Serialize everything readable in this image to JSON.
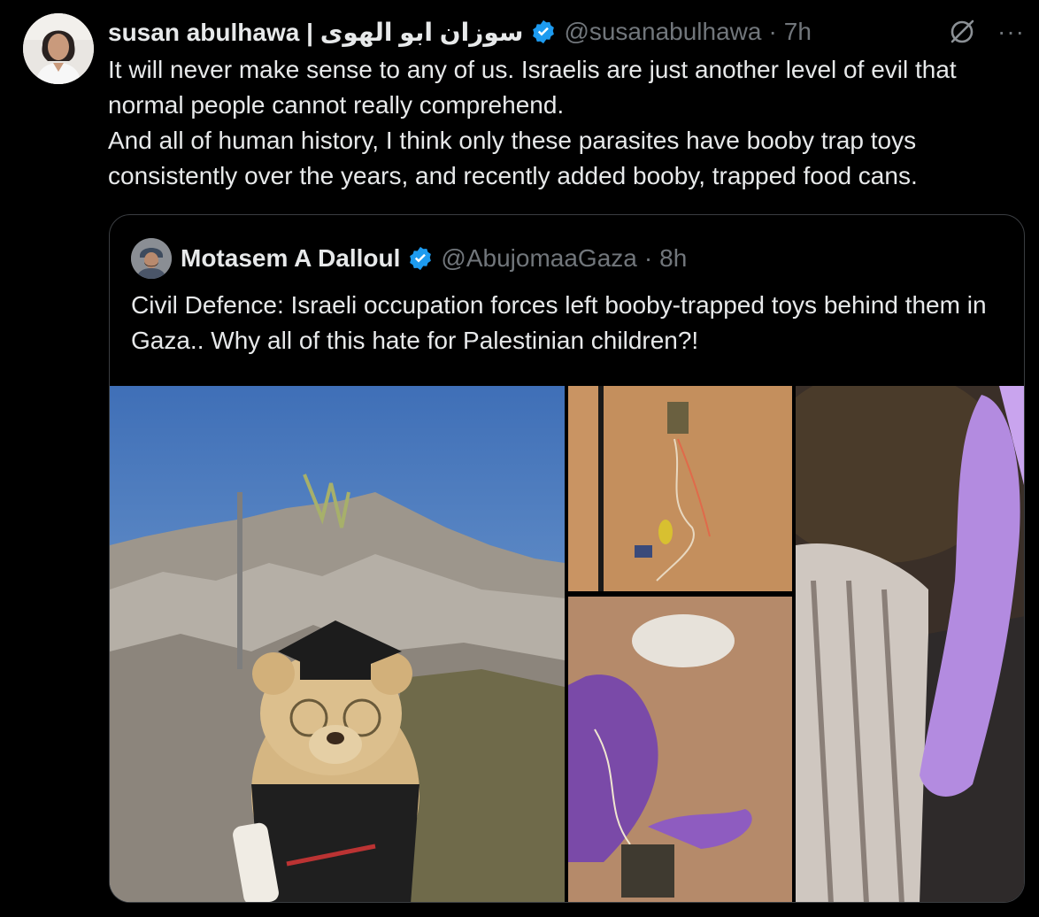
{
  "tweet": {
    "display_name": "susan abulhawa | سوزان ابو الهوى",
    "handle": "@susanabulhawa",
    "separator": "·",
    "time": "7h",
    "more_label": "···",
    "paragraphs": [
      "It will never make sense to any of us. Israelis are just another level of evil that normal people cannot really comprehend.",
      "And all of human history, I think only these parasites have booby trap toys consistently over the years, and recently added booby, trapped food cans."
    ]
  },
  "quote": {
    "display_name": "Motasem A Dalloul",
    "handle": "@AbujomaaGaza",
    "separator": "·",
    "time": "8h",
    "text": "Civil Defence: Israeli occupation forces left booby-trapped toys behind them in Gaza.. Why all of this hate for Palestinian children?!"
  },
  "icons": {
    "verified": "verified-badge-icon",
    "grok": "grok-icon",
    "more": "more-icon"
  },
  "colors": {
    "background": "#000000",
    "text": "#e7e9ea",
    "secondary": "#71767b",
    "verified": "#1d9bf0",
    "border": "#3a3d41"
  }
}
